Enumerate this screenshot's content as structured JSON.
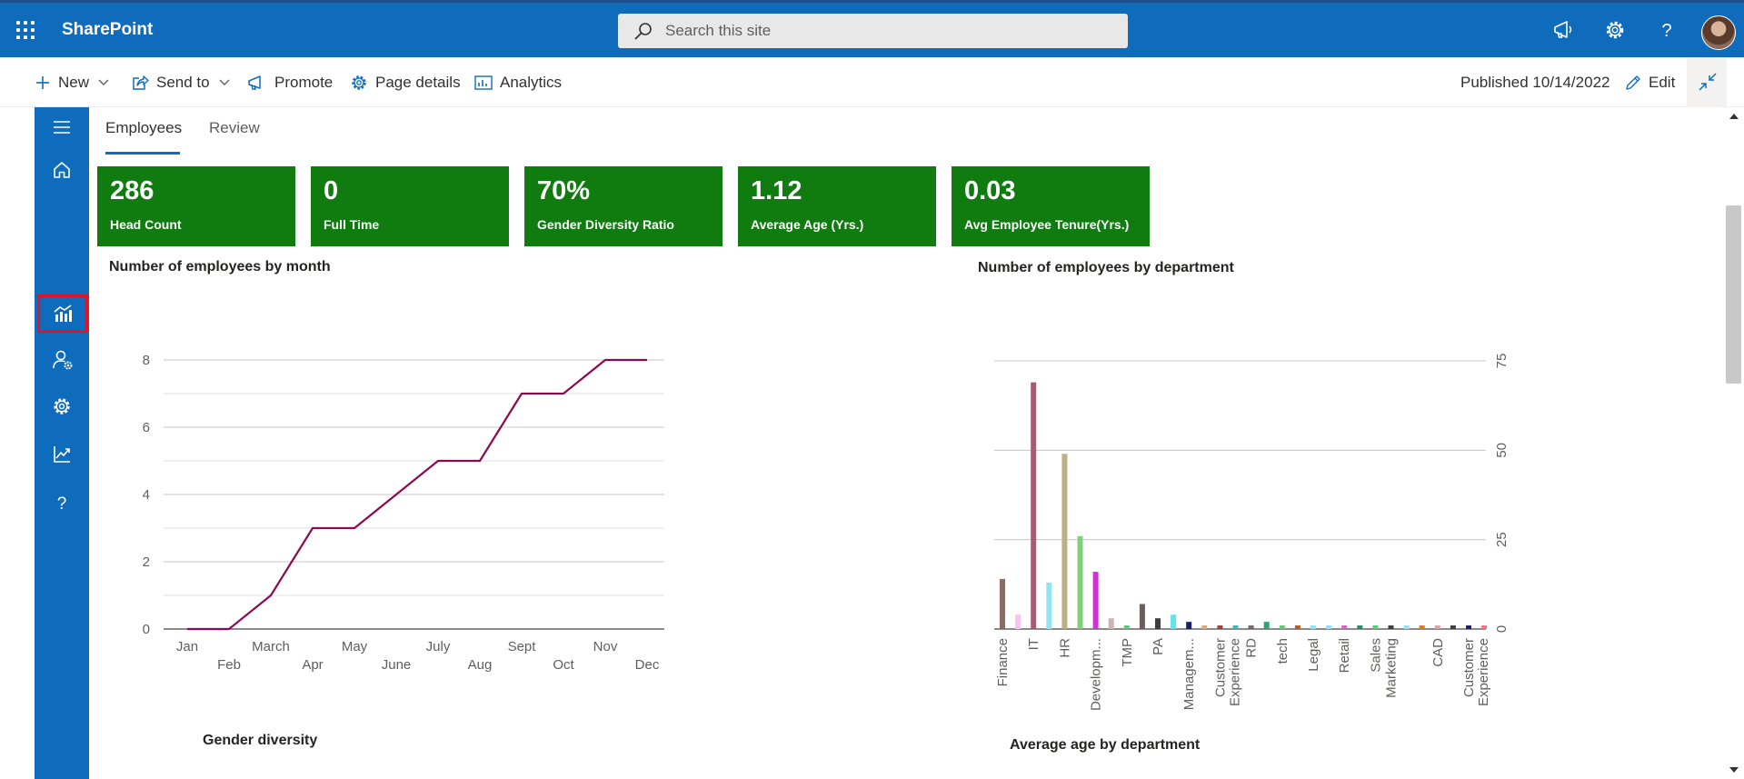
{
  "suite_bar": {
    "app_name": "SharePoint",
    "search_placeholder": "Search this site",
    "icons": [
      "waffle-icon",
      "megaphone-icon",
      "gear-icon",
      "help-icon",
      "avatar"
    ]
  },
  "command_bar": {
    "new_label": "New",
    "send_to_label": "Send to",
    "promote_label": "Promote",
    "page_details_label": "Page details",
    "analytics_label": "Analytics",
    "published_text": "Published 10/14/2022",
    "edit_label": "Edit"
  },
  "left_nav": {
    "items": [
      "menu-icon",
      "home-icon",
      "analytics-icon",
      "user-settings-icon",
      "gear-icon",
      "trend-icon",
      "help-icon"
    ],
    "highlighted_item": "analytics-icon"
  },
  "tabs": [
    {
      "label": "Employees",
      "active": true
    },
    {
      "label": "Review",
      "active": false
    }
  ],
  "kpis": [
    {
      "value": "286",
      "label": "Head Count"
    },
    {
      "value": "0",
      "label": "Full Time"
    },
    {
      "value": "70%",
      "label": "Gender Diversity Ratio"
    },
    {
      "value": "1.12",
      "label": "Average Age (Yrs.)"
    },
    {
      "value": "0.03",
      "label": "Avg Employee Tenure(Yrs.)"
    }
  ],
  "section_titles": {
    "gender_diversity": "Gender diversity",
    "avg_age_by_department": "Average age by department"
  },
  "colors": {
    "brand_blue": "#0f6cbd",
    "kpi_green": "#107c10",
    "line_series": "#8b0a50",
    "highlight_red": "#e81123"
  },
  "chart_data": [
    {
      "type": "line",
      "title": "Number of employees by month",
      "xlabel": "",
      "ylabel": "",
      "categories": [
        "Jan",
        "Feb",
        "March",
        "Apr",
        "May",
        "June",
        "July",
        "Aug",
        "Sept",
        "Oct",
        "Nov",
        "Dec"
      ],
      "values": [
        0,
        0,
        1,
        3,
        3,
        4,
        5,
        5,
        7,
        7,
        8,
        8
      ],
      "ylim": [
        0,
        8
      ],
      "yticks": [
        "0",
        "2",
        "4",
        "6",
        "8"
      ],
      "grid": true
    },
    {
      "type": "bar",
      "title": "Number of employees by department",
      "xlabel": "",
      "ylabel": "",
      "categories": [
        "Finance",
        "",
        "IT",
        "",
        "HR",
        "",
        "Developm...",
        "",
        "TMP",
        "",
        "PA",
        "",
        "Managem...",
        "",
        "Customer Experience",
        "",
        "RD",
        "",
        "tech",
        "",
        "Legal",
        "",
        "Retail",
        "",
        "Sales",
        "Marketing",
        "",
        "",
        "CAD",
        "",
        "Customer Experience",
        ""
      ],
      "values": [
        14,
        4,
        69,
        13,
        49,
        26,
        16,
        3,
        1,
        7,
        3,
        4,
        2,
        1,
        1,
        1,
        1,
        2,
        1,
        1,
        1,
        1,
        1,
        1,
        1,
        1,
        1,
        1,
        1,
        1,
        1,
        1
      ],
      "colors": [
        "#8c6b64",
        "#f5c4f2",
        "#a65b70",
        "#8fe3f5",
        "#bfae80",
        "#7ed17a",
        "#d42fd6",
        "#ccb3b3",
        "#5ccc7e",
        "#6e5b5b",
        "#3d3d3d",
        "#5ee3f0",
        "#1f1f66",
        "#d9a97a",
        "#a63d3d",
        "#3db8b8",
        "#6b6b6b",
        "#2ea36b",
        "#5ccc6e",
        "#ba5b1f",
        "#8fe3f5",
        "#8fe3f5",
        "#e05ccc",
        "#2e8a5b",
        "#5ccc7e",
        "#3d3d3d",
        "#8fe3f5",
        "#d97a1f",
        "#d9a3a3",
        "#3d3d3d",
        "#1f1f66",
        "#ff6b8a"
      ],
      "ylim": [
        0,
        75
      ],
      "yticks": [
        "0",
        "25",
        "50",
        "75"
      ],
      "y_axis_position": "right",
      "grid": true
    }
  ]
}
